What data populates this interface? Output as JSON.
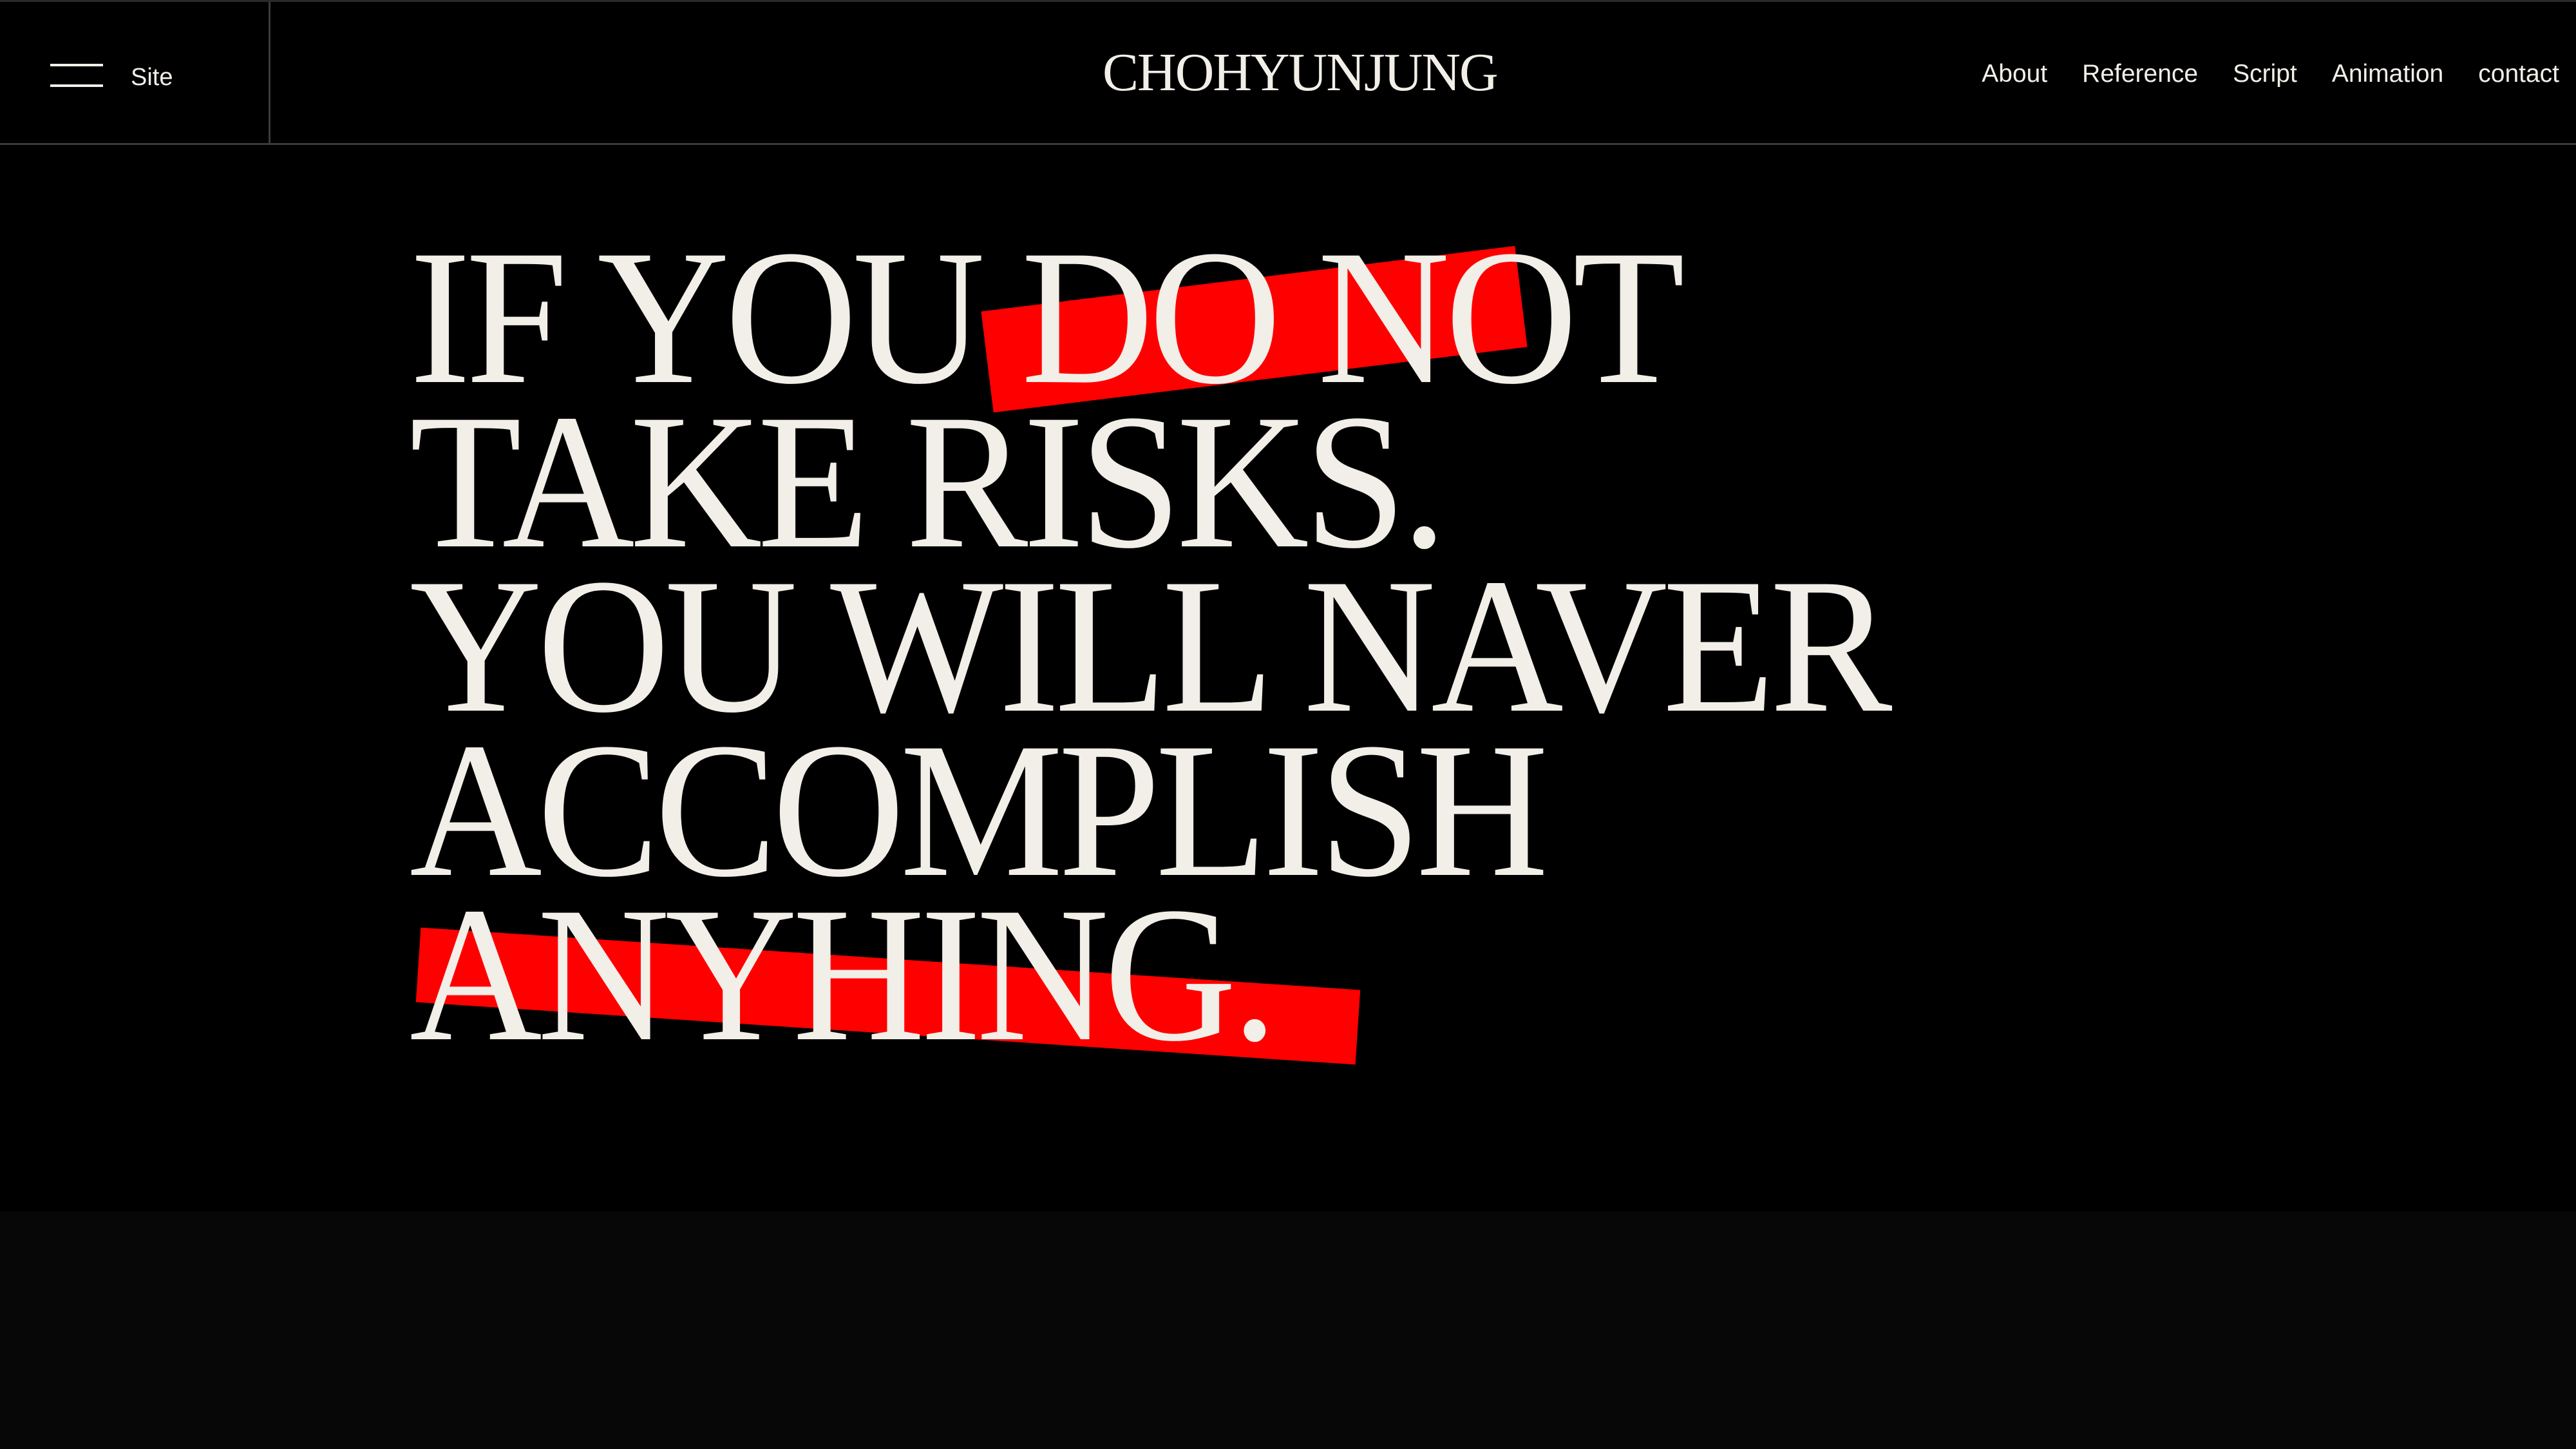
{
  "header": {
    "menu_label": "Site",
    "logo": "CHOHYUNJUNG",
    "nav": [
      "About",
      "Reference",
      "Script",
      "Animation",
      "contact"
    ]
  },
  "hero": {
    "lines": [
      "IF YOU DO NOT",
      "TAKE RISKS.",
      "YOU WILL NAVER",
      "ACCOMPLISH",
      "ANYHING."
    ],
    "highlighted_words": [
      "RISKS",
      "ANYHING."
    ]
  },
  "colors": {
    "background": "#000000",
    "text": "#f2eee8",
    "accent": "#ff0000",
    "divider": "#3a3a3a"
  },
  "icons": {
    "menu": "hamburger-icon"
  }
}
